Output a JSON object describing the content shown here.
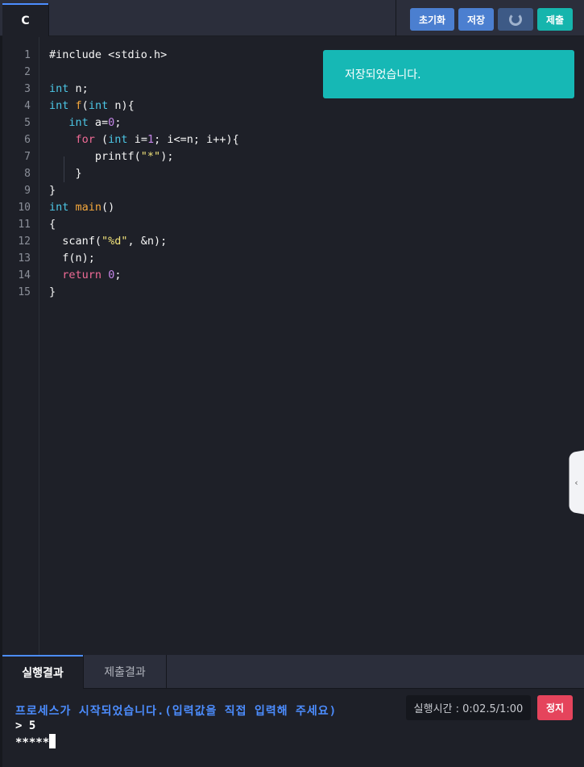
{
  "tabs": {
    "language": "C"
  },
  "toolbar": {
    "reset_label": "초기화",
    "save_label": "저장",
    "submit_label": "제출",
    "run_state": "spinner-icon"
  },
  "toast": {
    "message": "저장되었습니다."
  },
  "editor": {
    "line_numbers": [
      "1",
      "2",
      "3",
      "4",
      "5",
      "6",
      "7",
      "8",
      "9",
      "10",
      "11",
      "12",
      "13",
      "14",
      "15"
    ],
    "code": [
      [
        {
          "t": "#include <stdio.h>",
          "c": "op"
        }
      ],
      [],
      [
        {
          "t": "int",
          "c": "kw"
        },
        {
          "t": " n;",
          "c": "op"
        }
      ],
      [
        {
          "t": "int",
          "c": "kw"
        },
        {
          "t": " ",
          "c": "op"
        },
        {
          "t": "f",
          "c": "fn"
        },
        {
          "t": "(",
          "c": "op"
        },
        {
          "t": "int",
          "c": "kw"
        },
        {
          "t": " n){",
          "c": "op"
        }
      ],
      [
        {
          "t": "   ",
          "c": "op"
        },
        {
          "t": "int",
          "c": "kw"
        },
        {
          "t": " a=",
          "c": "op"
        },
        {
          "t": "0",
          "c": "num"
        },
        {
          "t": ";",
          "c": "op"
        }
      ],
      [
        {
          "t": "    ",
          "c": "op"
        },
        {
          "t": "for",
          "c": "rt"
        },
        {
          "t": " (",
          "c": "op"
        },
        {
          "t": "int",
          "c": "kw"
        },
        {
          "t": " i=",
          "c": "op"
        },
        {
          "t": "1",
          "c": "num"
        },
        {
          "t": "; i<=n; i++){",
          "c": "op"
        }
      ],
      [
        {
          "t": "       printf(",
          "c": "op"
        },
        {
          "t": "\"*\"",
          "c": "str"
        },
        {
          "t": ");",
          "c": "op"
        }
      ],
      [
        {
          "t": "    }",
          "c": "op"
        }
      ],
      [
        {
          "t": "}",
          "c": "op"
        }
      ],
      [
        {
          "t": "int",
          "c": "kw"
        },
        {
          "t": " ",
          "c": "op"
        },
        {
          "t": "main",
          "c": "fn"
        },
        {
          "t": "()",
          "c": "op"
        }
      ],
      [
        {
          "t": "{",
          "c": "op"
        }
      ],
      [
        {
          "t": "  scanf(",
          "c": "op"
        },
        {
          "t": "\"%d\"",
          "c": "str"
        },
        {
          "t": ", &n);",
          "c": "op"
        }
      ],
      [
        {
          "t": "  f(n);",
          "c": "op"
        }
      ],
      [
        {
          "t": "  ",
          "c": "op"
        },
        {
          "t": "return",
          "c": "rt"
        },
        {
          "t": " ",
          "c": "op"
        },
        {
          "t": "0",
          "c": "num"
        },
        {
          "t": ";",
          "c": "op"
        }
      ],
      [
        {
          "t": "}",
          "c": "op"
        }
      ]
    ]
  },
  "result_tabs": {
    "run_result": "실행결과",
    "submit_result": "제출결과"
  },
  "console": {
    "message": "프로세스가 시작되었습니다.(입력값을 직접 입력해 주세요)",
    "input": "> 5",
    "output": "*****",
    "timer": "실행시간 : 0:02.5/1:00",
    "stop_label": "정지"
  },
  "colors": {
    "accent": "#4c8dff",
    "teal": "#16b5ad",
    "stop": "#e5445c"
  }
}
